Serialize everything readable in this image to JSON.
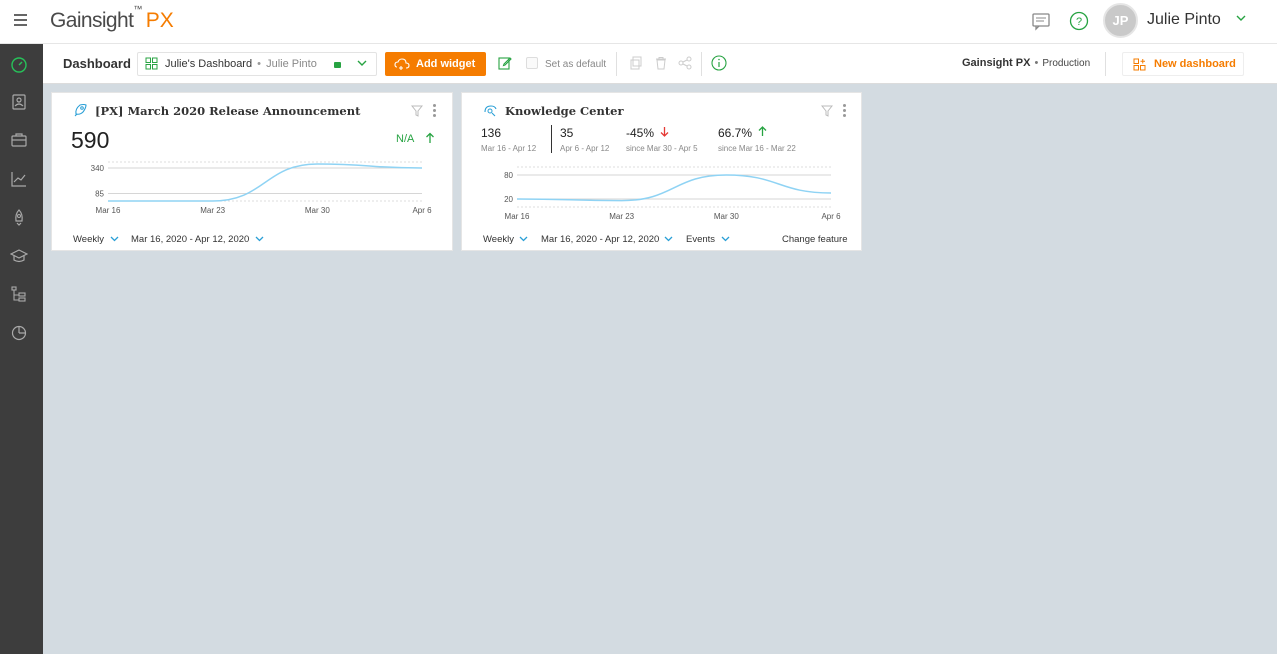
{
  "header": {
    "brand": "Gainsight",
    "brand_mark": "™",
    "brand_px": "PX",
    "user_initials": "JP",
    "user_name": "Julie Pinto"
  },
  "toolbar": {
    "title": "Dashboard",
    "dashboard_name": "Julie's Dashboard",
    "dashboard_sep": "•",
    "dashboard_owner": "Julie Pinto",
    "add_widget": "Add widget",
    "set_default": "Set as default",
    "product": "Gainsight PX",
    "product_sep": "•",
    "environment": "Production",
    "new_dashboard": "New dashboard"
  },
  "nav_icons": [
    "speedometer-icon",
    "people-icon",
    "briefcase-icon",
    "line-chart-icon",
    "rocket-icon",
    "graduation-cap-icon",
    "tree-icon",
    "pie-chart-icon"
  ],
  "colors": {
    "accent": "#f57c00",
    "nav_bg": "#3d3d3d",
    "canvas_bg": "#d3dbe1",
    "positive": "#27a342",
    "negative": "#e53935",
    "line": "#8fd3f4"
  },
  "widget1": {
    "title": "[PX] March 2020 Release Announcement",
    "value": "590",
    "change": "N/A",
    "period_label": "Weekly",
    "date_range": "Mar 16, 2020 - Apr 12, 2020"
  },
  "widget2": {
    "title": "Knowledge Center",
    "stats": [
      {
        "value": "136",
        "label": "Mar 16 - Apr 12"
      },
      {
        "value": "35",
        "label": "Apr 6 - Apr 12"
      },
      {
        "value": "-45%",
        "label": "since Mar 30 - Apr 5"
      },
      {
        "value": "66.7%",
        "label": "since Mar 16 - Mar 22"
      }
    ],
    "period_label": "Weekly",
    "date_range": "Mar 16, 2020 - Apr 12, 2020",
    "metric": "Events",
    "change_feature": "Change feature"
  },
  "chart_data": [
    {
      "type": "line",
      "title": "",
      "x": [
        "Mar 16",
        "Mar 23",
        "Mar 30",
        "Apr 6"
      ],
      "series": [
        {
          "values": [
            10,
            10,
            380,
            340
          ]
        }
      ],
      "y_ticks": [
        85,
        340
      ],
      "ylim": [
        10,
        400
      ],
      "grid": true
    },
    {
      "type": "line",
      "title": "",
      "x": [
        "Mar 16",
        "Mar 23",
        "Mar 30",
        "Apr 6"
      ],
      "series": [
        {
          "values": [
            20,
            16,
            80,
            35
          ]
        }
      ],
      "y_ticks": [
        20,
        80
      ],
      "ylim": [
        0,
        100
      ],
      "grid": true
    }
  ]
}
